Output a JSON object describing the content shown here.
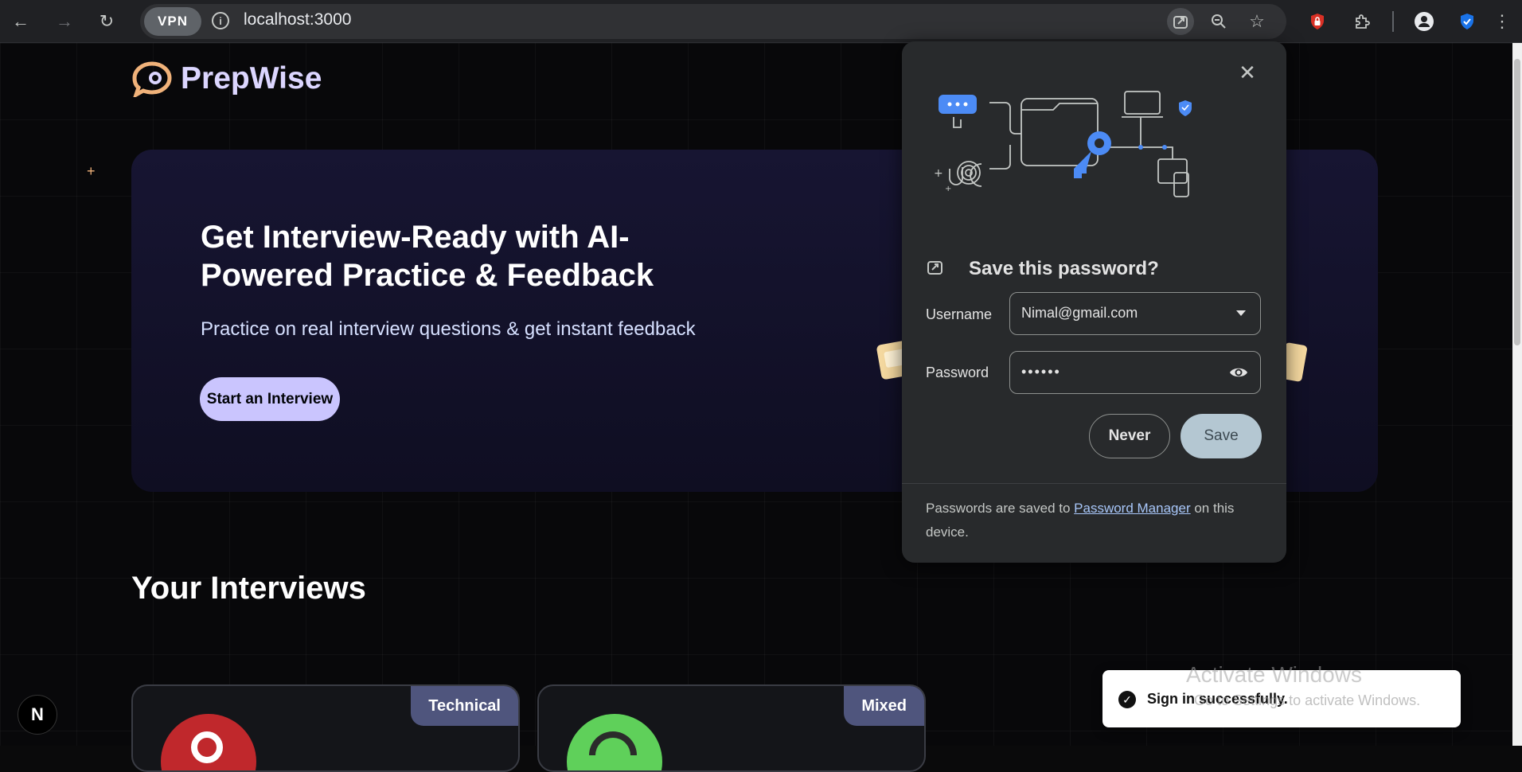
{
  "browser": {
    "url": "localhost:3000",
    "vpn_label": "VPN"
  },
  "app": {
    "brand": "PrepWise"
  },
  "hero": {
    "title": "Get Interview-Ready with AI-Powered Practice & Feedback",
    "subtitle": "Practice on real interview questions & get instant feedback",
    "cta": "Start an Interview"
  },
  "interviews": {
    "heading": "Your Interviews",
    "cards": [
      {
        "type": "Technical",
        "avatar_color": "#c0282c"
      },
      {
        "type": "Mixed",
        "avatar_color": "#5fd05a"
      }
    ]
  },
  "password_popup": {
    "title": "Save this password?",
    "username_label": "Username",
    "username_value": "Nimal@gmail.com",
    "password_label": "Password",
    "password_value": "••••••",
    "never_label": "Never",
    "save_label": "Save",
    "footer_before": "Passwords are saved to ",
    "footer_link": "Password Manager",
    "footer_after": " on this device."
  },
  "toast": {
    "message": "Sign in successfully."
  },
  "watermark": {
    "title": "Activate Windows",
    "subtitle": "Go to Settings to activate Windows."
  },
  "dev_indicator": "N",
  "colors": {
    "accent": "#cac5fe",
    "brand": "#dcd6ff",
    "popup_bg": "#282a2c",
    "badge": "#4f557d"
  }
}
